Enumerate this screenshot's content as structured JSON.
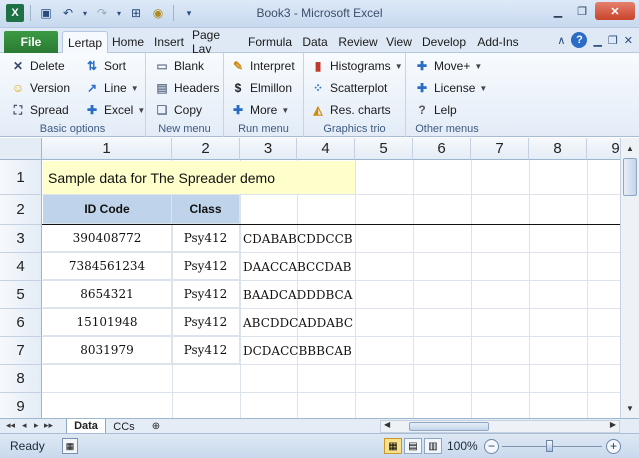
{
  "window": {
    "title": "Book3  -  Microsoft Excel"
  },
  "qat_icons": [
    "excel-logo",
    "save-icon",
    "undo-icon",
    "redo-icon",
    "layout-icon",
    "lertap-icon",
    "customize-qat-icon"
  ],
  "tabs": [
    "File",
    "Lertap",
    "Home",
    "Insert",
    "Page Lay",
    "Formula",
    "Data",
    "Review",
    "View",
    "Develop",
    "Add-Ins"
  ],
  "active_tab": "Lertap",
  "ribbon": {
    "groups": {
      "basic": {
        "label": "Basic options",
        "buttons": [
          "Delete",
          "Sort",
          "Version",
          "Line",
          "Spread",
          "Excel"
        ]
      },
      "new_menu": {
        "label": "New menu",
        "buttons": [
          "Blank",
          "Headers",
          "Copy"
        ]
      },
      "run_menu": {
        "label": "Run menu",
        "buttons": [
          "Interpret",
          "Elmillon",
          "More"
        ]
      },
      "graphics": {
        "label": "Graphics trio",
        "buttons": [
          "Histograms",
          "Scatterplot",
          "Res. charts"
        ]
      },
      "other_menus": {
        "label": "Other menus",
        "buttons": [
          "Move+",
          "License",
          "Lelp"
        ]
      }
    }
  },
  "sheet": {
    "columns": [
      "1",
      "2",
      "3",
      "4",
      "5",
      "6",
      "7",
      "8",
      "9"
    ],
    "rows": [
      "1",
      "2",
      "3",
      "4",
      "5",
      "6",
      "7",
      "8",
      "9"
    ],
    "title_cell": "Sample data for The Spreader demo",
    "header": {
      "id": "ID Code",
      "class": "Class"
    },
    "data": [
      {
        "id": "390408772",
        "class": "Psy412",
        "resp": "CDABABCDDCCB"
      },
      {
        "id": "7384561234",
        "class": "Psy412",
        "resp": "DAACCABCCDAB"
      },
      {
        "id": "8654321",
        "class": "Psy412",
        "resp": "BAADCADDDBCA"
      },
      {
        "id": "15101948",
        "class": "Psy412",
        "resp": "ABCDDCADDABC"
      },
      {
        "id": "8031979",
        "class": "Psy412",
        "resp": "DCDACCBBBCAB"
      }
    ]
  },
  "sheet_tabs": [
    "Data",
    "CCs"
  ],
  "active_sheet": "Data",
  "status": {
    "ready": "Ready",
    "zoom": "100%"
  },
  "colors": {
    "title_fill": "#ffffcc",
    "header_fill": "#bfd3ea",
    "file_tab": "#2f8a38"
  }
}
